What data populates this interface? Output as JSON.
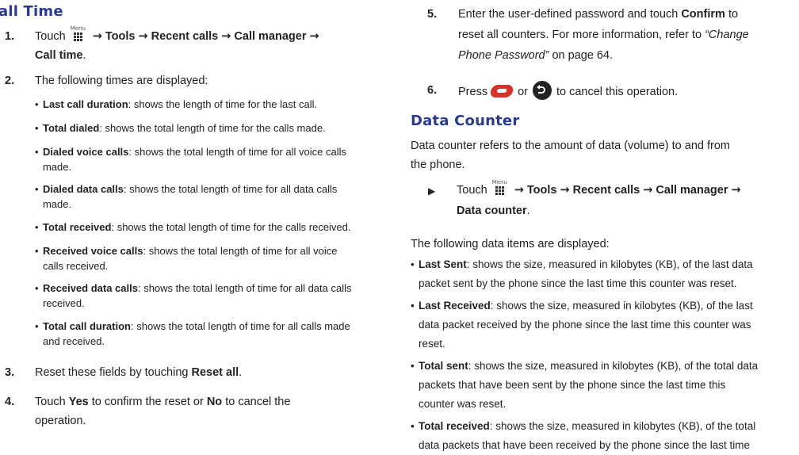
{
  "left": {
    "title": "all Time",
    "step1": {
      "num": "1.",
      "touch": "Touch",
      "menu_icon_label": "Menu",
      "path_tools": "Tools",
      "path_recent": "Recent calls",
      "path_manager": "Call manager",
      "path_end": "Call time",
      "period": "."
    },
    "step2": {
      "num": "2.",
      "text": "The following times are displayed:"
    },
    "bullets": [
      {
        "bold": "Last call duration",
        "rest": ": shows the length of time for the last call.",
        "rest2": ""
      },
      {
        "bold": "Total dialed",
        "rest": ": shows the total length of time for the calls made.",
        "rest2": ""
      },
      {
        "bold": "Dialed voice calls",
        "rest": ": shows the total length of time for all voice calls",
        "rest2": "made."
      },
      {
        "bold": "Dialed data calls",
        "rest": ": shows the total length of time for all data calls",
        "rest2": "made."
      },
      {
        "bold": "Total received",
        "rest": ": shows the total length of time for the calls received.",
        "rest2": ""
      },
      {
        "bold": "Received voice calls",
        "rest": ": shows the total length of time for all voice",
        "rest2": "calls received."
      },
      {
        "bold": "Received data calls",
        "rest": ": shows the total length of time for all data calls",
        "rest2": "received."
      },
      {
        "bold": "Total call duration",
        "rest": ": shows the total length of time for all calls made",
        "rest2": "and received."
      }
    ],
    "step3": {
      "num": "3.",
      "pre": "Reset these fields by touching ",
      "bold": "Reset all",
      "post": "."
    },
    "step4": {
      "num": "4.",
      "pre": "Touch ",
      "yes": "Yes",
      "mid": " to confirm the reset or ",
      "no": "No",
      "post": " to cancel the",
      "line2": "operation."
    }
  },
  "right": {
    "step5": {
      "num": "5.",
      "line1_pre": "Enter the user-defined password and touch ",
      "line1_bold": "Confirm",
      "line1_post": " to",
      "line2": "reset all counters. For more information, refer to ",
      "line2_italic": "“Change",
      "line3_italic": "Phone Password”",
      "line3_post": " on page 64."
    },
    "step6": {
      "num": "6.",
      "press": "Press",
      "or": "or",
      "post": "to cancel this operation."
    },
    "title": "Data Counter",
    "intro1": "Data counter refers to the amount of data (volume) to and from",
    "intro2": "the phone.",
    "touch_line": {
      "touch": "Touch",
      "menu_icon_label": "Menu",
      "path_tools": "Tools",
      "path_recent": "Recent calls",
      "path_manager": "Call manager",
      "path_end": "Data counter",
      "period": "."
    },
    "following": "The following data items are displayed:",
    "bullets": [
      {
        "bold": "Last Sent",
        "l1": ": shows the size, measured in kilobytes (KB), of the last data",
        "l2": "packet sent by the phone since the last time this counter was reset.",
        "l3": ""
      },
      {
        "bold": "Last Received",
        "l1": ": shows the size, measured in kilobytes (KB), of the last",
        "l2": "data packet received by the phone since the last time this counter was",
        "l3": "reset."
      },
      {
        "bold": "Total sent",
        "l1": ": shows the size, measured in kilobytes (KB), of the total data",
        "l2": "packets that have been sent by the phone since the last time this",
        "l3": "counter was reset."
      },
      {
        "bold": "Total received",
        "l1": ": shows the size, measured in kilobytes (KB), of the total",
        "l2": "data packets that have been received by the phone since the last time",
        "l3": ""
      }
    ]
  },
  "colors": {
    "heading": "#2a3a8f",
    "text": "#222222",
    "end_key": "#d9302a"
  }
}
